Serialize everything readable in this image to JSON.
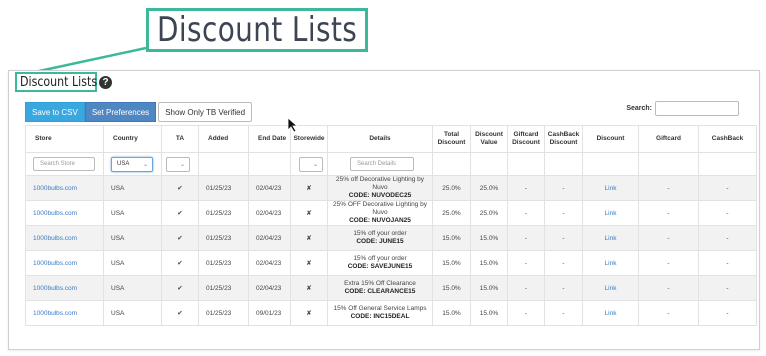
{
  "callout": {
    "title": "Discount Lists"
  },
  "header": {
    "title": "Discount Lists",
    "help_icon": "question-circle-icon"
  },
  "toolbar": {
    "save_csv": "Save to CSV",
    "set_preferences": "Set Preferences",
    "verified_toggle": "Show Only TB Verified"
  },
  "search": {
    "label": "Search:",
    "value": ""
  },
  "columns": [
    "Store",
    "Country",
    "TA",
    "Added",
    "End Date",
    "Storewide",
    "Details",
    "Total Discount",
    "Discount Value",
    "Giftcard Discount",
    "CashBack Discount",
    "Discount",
    "Giftcard",
    "CashBack"
  ],
  "filters": {
    "store_placeholder": "Search Store",
    "country_value": "USA",
    "details_placeholder": "Search Details"
  },
  "rows": [
    {
      "store": "1000bulbs.com",
      "country": "USA",
      "ta": "✔",
      "added": "01/25/23",
      "end": "02/04/23",
      "storewide": "✘",
      "details": "25% off Decorative Lighting by Nuvo",
      "code": "CODE: NUVODEC25",
      "total": "25.0%",
      "value": "25.0%",
      "giftcard_discount": "-",
      "cashback_discount": "-",
      "discount": "Link",
      "giftcard": "-",
      "cashback": "-"
    },
    {
      "store": "1000bulbs.com",
      "country": "USA",
      "ta": "✔",
      "added": "01/25/23",
      "end": "02/04/23",
      "storewide": "✘",
      "details": "25% OFF Decorative Lighting by Nuvo",
      "code": "CODE: NUVOJAN25",
      "total": "25.0%",
      "value": "25.0%",
      "giftcard_discount": "-",
      "cashback_discount": "-",
      "discount": "Link",
      "giftcard": "-",
      "cashback": "-"
    },
    {
      "store": "1000bulbs.com",
      "country": "USA",
      "ta": "✔",
      "added": "01/25/23",
      "end": "02/04/23",
      "storewide": "✘",
      "details": "15% off your order",
      "code": "CODE: JUNE15",
      "total": "15.0%",
      "value": "15.0%",
      "giftcard_discount": "-",
      "cashback_discount": "-",
      "discount": "Link",
      "giftcard": "-",
      "cashback": "-"
    },
    {
      "store": "1000bulbs.com",
      "country": "USA",
      "ta": "✔",
      "added": "01/25/23",
      "end": "02/04/23",
      "storewide": "✘",
      "details": "15% off your order",
      "code": "CODE: SAVEJUNE15",
      "total": "15.0%",
      "value": "15.0%",
      "giftcard_discount": "-",
      "cashback_discount": "-",
      "discount": "Link",
      "giftcard": "-",
      "cashback": "-"
    },
    {
      "store": "1000bulbs.com",
      "country": "USA",
      "ta": "✔",
      "added": "01/25/23",
      "end": "02/04/23",
      "storewide": "✘",
      "details": "Extra 15% Off Clearance",
      "code": "CODE: CLEARANCE15",
      "total": "15.0%",
      "value": "15.0%",
      "giftcard_discount": "-",
      "cashback_discount": "-",
      "discount": "Link",
      "giftcard": "-",
      "cashback": "-"
    },
    {
      "store": "1000bulbs.com",
      "country": "USA",
      "ta": "✔",
      "added": "01/25/23",
      "end": "09/01/23",
      "storewide": "✘",
      "details": "15% Off General Service Lamps",
      "code": "CODE: INC15DEAL",
      "total": "15.0%",
      "value": "15.0%",
      "giftcard_discount": "-",
      "cashback_discount": "-",
      "discount": "Link",
      "giftcard": "-",
      "cashback": "-"
    }
  ],
  "colors": {
    "accent": "#3cb89a",
    "button": "#3aa7de",
    "link": "#3a7cc4"
  }
}
